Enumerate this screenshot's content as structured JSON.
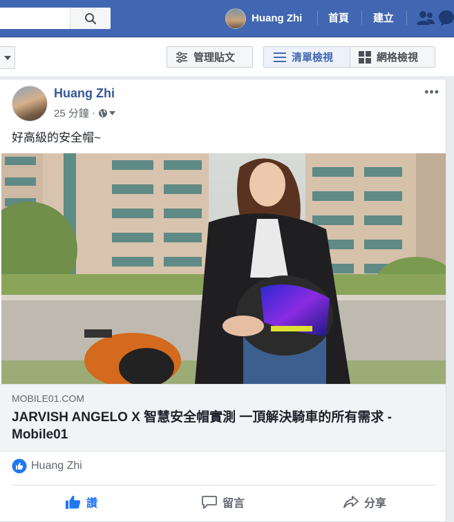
{
  "topbar": {
    "user_name": "Huang Zhi",
    "home_label": "首頁",
    "create_label": "建立"
  },
  "toolbar": {
    "manage_label": "管理貼文",
    "list_view_label": "清單檢視",
    "grid_view_label": "網格檢視"
  },
  "post": {
    "author": "Huang Zhi",
    "time": "25 分鐘",
    "separator": "·",
    "more_label": "•••",
    "text": "好高級的安全帽~",
    "link": {
      "domain": "MOBILE01.COM",
      "title": "JARVISH ANGELO X 智慧安全帽實測 一頂解決騎車的所有需求 - Mobile01"
    },
    "reactions": {
      "liker": "Huang Zhi"
    },
    "actions": {
      "like_label": "讚",
      "comment_label": "留言",
      "share_label": "分享"
    }
  },
  "colors": {
    "brand": "#4267b2",
    "link_name": "#365899",
    "like_blue": "#2078f4"
  }
}
